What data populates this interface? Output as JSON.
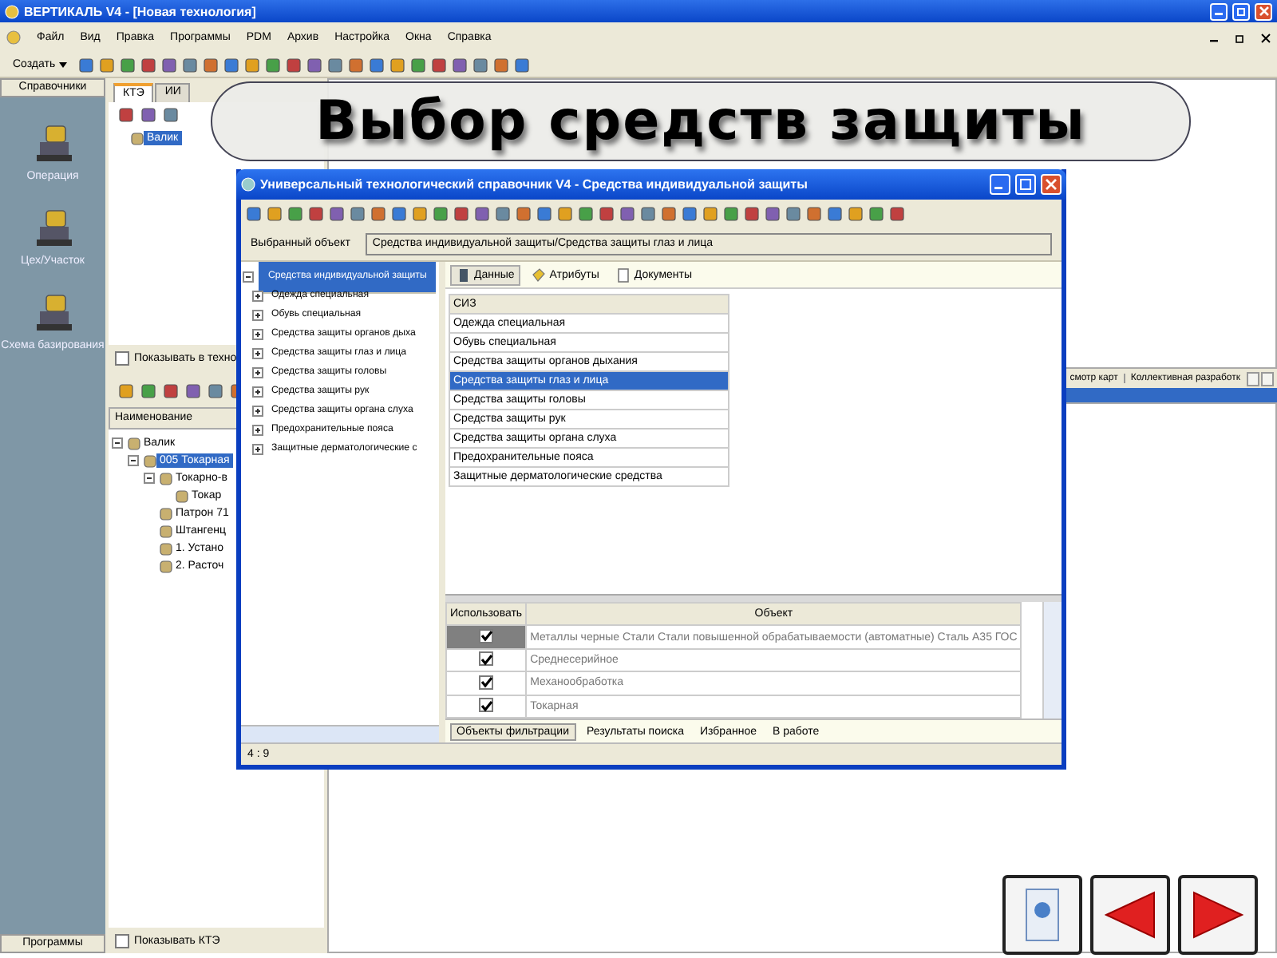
{
  "slide_title": "Выбор средств защиты",
  "app_window": {
    "title": "ВЕРТИКАЛЬ V4 - [Новая технология]",
    "menu": [
      "Файл",
      "Вид",
      "Правка",
      "Программы",
      "PDM",
      "Архив",
      "Настройка",
      "Окна",
      "Справка"
    ],
    "create_button": "Создать",
    "sidebar": {
      "header": "Справочники",
      "items": [
        "Операция",
        "Цех/Участок",
        "Схема базирования"
      ],
      "footer": "Программы"
    },
    "tabs": [
      {
        "label": "КТЭ",
        "selected": true
      },
      {
        "label": "ИИ",
        "selected": false
      }
    ],
    "top_tree": [
      {
        "label": "Валик",
        "selected": true
      }
    ],
    "show_in_tech": {
      "label": "Показывать в техно",
      "checked": false
    },
    "structure_header": "Наименование",
    "structure_tree": [
      {
        "label": "Валик",
        "selected": false,
        "expanded": true,
        "children": [
          {
            "label": "005 Токарная",
            "selected": true,
            "expanded": true,
            "children": [
              {
                "label": "Токарно-в",
                "selected": false,
                "expanded": true,
                "children": [
                  {
                    "label": "Токар",
                    "selected": false
                  }
                ]
              },
              {
                "label": "Патрон 71",
                "selected": false
              },
              {
                "label": "Штангенц",
                "selected": false
              },
              {
                "label": "1. Устано",
                "selected": false
              },
              {
                "label": "2. Расточ",
                "selected": false
              }
            ]
          }
        ]
      }
    ],
    "show_kte": {
      "label": "Показывать КТЭ",
      "checked": false
    },
    "right_tabs": [
      "смотр карт",
      "Коллективная разработк"
    ]
  },
  "dialog": {
    "title": "Универсальный технологический справочник V4 - Средства индивидуальной защиты",
    "selected_object_label": "Выбранный объект",
    "selected_object": "Средства индивидуальной защиты/Средства защиты глаз и лица",
    "tree": [
      {
        "label": "Средства индивидуальной защиты",
        "selected": true,
        "expanded": true,
        "children": [
          {
            "label": "Одежда специальная",
            "selected": false,
            "expanded": false
          },
          {
            "label": "Обувь специальная",
            "selected": false,
            "expanded": false
          },
          {
            "label": "Средства защиты органов дыха",
            "selected": false,
            "expanded": false
          },
          {
            "label": "Средства защиты глаз и лица",
            "selected": false,
            "expanded": false
          },
          {
            "label": "Средства защиты головы",
            "selected": false,
            "expanded": false
          },
          {
            "label": "Средства защиты рук",
            "selected": false,
            "expanded": false
          },
          {
            "label": "Средства защиты органа слуха",
            "selected": false,
            "expanded": false
          },
          {
            "label": "Предохранительные пояса",
            "selected": false,
            "expanded": false
          },
          {
            "label": "Защитные дерматологические с",
            "selected": false,
            "expanded": false
          }
        ]
      }
    ],
    "tabs": [
      {
        "label": "Данные",
        "selected": true
      },
      {
        "label": "Атрибуты",
        "selected": false
      },
      {
        "label": "Документы",
        "selected": false
      }
    ],
    "table": {
      "column": "СИЗ",
      "rows": [
        {
          "text": "Одежда специальная",
          "selected": false
        },
        {
          "text": "Обувь специальная",
          "selected": false
        },
        {
          "text": "Средства защиты органов дыхания",
          "selected": false
        },
        {
          "text": "Средства защиты глаз и лица",
          "selected": true
        },
        {
          "text": "Средства защиты головы",
          "selected": false
        },
        {
          "text": "Средства защиты рук",
          "selected": false
        },
        {
          "text": "Средства защиты органа слуха",
          "selected": false
        },
        {
          "text": "Предохранительные пояса",
          "selected": false
        },
        {
          "text": "Защитные дерматологические средства",
          "selected": false
        }
      ]
    },
    "filter_table": {
      "columns": [
        "Использовать",
        "Объект"
      ],
      "rows": [
        {
          "use": true,
          "object": "Металлы черные Стали Стали повышенной обрабатываемости (автоматные) Сталь А35 ГОС",
          "selected": true
        },
        {
          "use": true,
          "object": "Среднесерийное",
          "selected": false
        },
        {
          "use": true,
          "object": "Механообработка",
          "selected": false
        },
        {
          "use": true,
          "object": "Токарная",
          "selected": false
        }
      ]
    },
    "bottom_tabs": [
      {
        "label": "Объекты фильтрации",
        "selected": true
      },
      {
        "label": "Результаты поиска",
        "selected": false
      },
      {
        "label": "Избранное",
        "selected": false
      },
      {
        "label": "В работе",
        "selected": false
      }
    ],
    "status": "4 : 9"
  }
}
